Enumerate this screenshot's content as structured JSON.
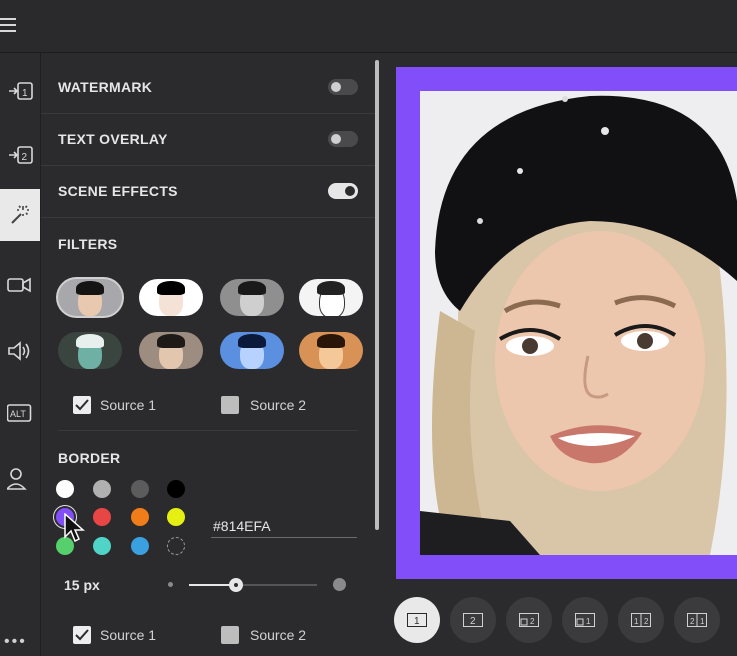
{
  "colors": {
    "accent": "#814efa",
    "panel_bg": "#2b2b2d",
    "text": "#e6e6e6"
  },
  "rail": {
    "items": [
      {
        "name": "camera-1",
        "label": "1"
      },
      {
        "name": "camera-2",
        "label": "2"
      },
      {
        "name": "effects",
        "icon": "magic-wand-icon",
        "active": true
      },
      {
        "name": "video",
        "icon": "video-camera-icon"
      },
      {
        "name": "audio",
        "icon": "speaker-icon"
      },
      {
        "name": "alt",
        "label": "ALT"
      },
      {
        "name": "profile",
        "icon": "user-icon"
      }
    ],
    "more": "•••"
  },
  "panel": {
    "watermark": {
      "label": "WATERMARK",
      "enabled": false
    },
    "text_overlay": {
      "label": "TEXT OVERLAY",
      "enabled": false
    },
    "scene_effects": {
      "label": "SCENE EFFECTS",
      "enabled": true
    },
    "filters": {
      "label": "FILTERS",
      "items": [
        {
          "name": "normal",
          "selected": true
        },
        {
          "name": "high-contrast"
        },
        {
          "name": "grayscale"
        },
        {
          "name": "sketch"
        },
        {
          "name": "teal-night"
        },
        {
          "name": "vintage"
        },
        {
          "name": "blue"
        },
        {
          "name": "warm"
        }
      ],
      "source1": {
        "label": "Source 1",
        "checked": true
      },
      "source2": {
        "label": "Source 2",
        "checked": false
      }
    },
    "border": {
      "label": "BORDER",
      "swatches": [
        "#ffffff",
        "#b0b0b0",
        "#5c5c5c",
        "#000000",
        "#814efa",
        "#e84545",
        "#f07c1a",
        "#e6ef12",
        "#55d06c",
        "#50d4c8",
        "#3aa0e0",
        "none"
      ],
      "selected_color": "#814EFA",
      "size_label": "15 px",
      "size_fraction": 0.37,
      "source1": {
        "label": "Source 1",
        "checked": true
      },
      "source2": {
        "label": "Source 2",
        "checked": false
      }
    }
  },
  "layouts": [
    {
      "name": "single",
      "label": "1",
      "active": true
    },
    {
      "name": "single-2",
      "label": "2"
    },
    {
      "name": "pip-left",
      "label": "12"
    },
    {
      "name": "pip-right",
      "label": "21"
    },
    {
      "name": "split-12",
      "label": "12"
    },
    {
      "name": "split-21",
      "label": "21"
    }
  ]
}
